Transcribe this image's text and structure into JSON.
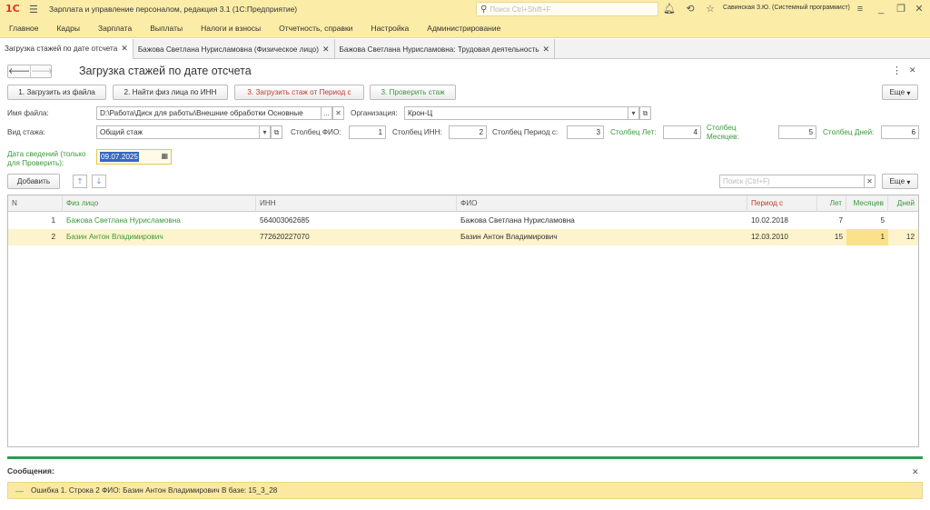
{
  "app": {
    "logo": "1С",
    "title": "Зарплата и управление персоналом, редакция 3.1  (1С:Предприятие)",
    "search_placeholder": "Поиск Ctrl+Shift+F",
    "user": "Савинская З.Ю. (Системный программист)"
  },
  "main_menu": [
    "Главное",
    "Кадры",
    "Зарплата",
    "Выплаты",
    "Налоги и взносы",
    "Отчетность, справки",
    "Настройка",
    "Администрирование"
  ],
  "tabs": [
    {
      "label": "Загрузка стажей по дате отсчета"
    },
    {
      "label": "Бажова Светлана Нурисламовна (Физическое лицо)"
    },
    {
      "label": "Бажова Светлана Нурисламовна: Трудовая деятельность"
    }
  ],
  "form": {
    "title": "Загрузка стажей по дате отсчета",
    "buttons": {
      "load_file": "1. Загрузить из файла",
      "find_by_inn": "2. Найти физ лица по ИНН",
      "load_from_period": "3. Загрузить стаж от Период с",
      "check": "3. Проверить стаж",
      "more": "Еще"
    },
    "file_label": "Имя файла:",
    "file_value": "D:\\Работа\\Диск для работы\\Внешние обработки Основные",
    "ellipsis": "...",
    "org_label": "Организация:",
    "org_value": "Крон-Ц",
    "type_label": "Вид стажа:",
    "type_value": "Общий стаж",
    "col_fio_label": "Столбец ФИО:",
    "col_fio_value": "1",
    "col_inn_label": "Столбец ИНН:",
    "col_inn_value": "2",
    "col_period_label": "Столбец Период с:",
    "col_period_value": "3",
    "col_years_label": "Столбец Лет:",
    "col_years_value": "4",
    "col_months_label_1": "Столбец",
    "col_months_label_2": "Месяцев:",
    "col_months_value": "5",
    "col_days_label": "Столбец Дней:",
    "col_days_value": "6",
    "date_label_1": "Дата сведений (только",
    "date_label_2": "для Проверить):",
    "date_value": "09.07.2025",
    "add_button": "Добавить",
    "table_search_placeholder": "Поиск (Ctrl+F)",
    "table_more": "Еще"
  },
  "table": {
    "headers": {
      "n": "N",
      "person": "Физ лицо",
      "inn": "ИНН",
      "fio": "ФИО",
      "period": "Период с",
      "years": "Лет",
      "months": "Месяцев",
      "days": "Дней"
    },
    "rows": [
      {
        "n": "1",
        "person": "Бажова Светлана Нурисламовна",
        "inn": "564003062685",
        "fio": "Бажова Светлана Нурисламовна",
        "period": "10.02.2018",
        "years": "7",
        "months": "5",
        "days": ""
      },
      {
        "n": "2",
        "person": "Базин Антон Владимирович",
        "inn": "772620227070",
        "fio": "Базин Антон Владимирович",
        "period": "12.03.2010",
        "years": "15",
        "months": "1",
        "days": "12"
      }
    ]
  },
  "messages": {
    "title": "Сообщения:",
    "items": [
      "Ошибка 1. Строка 2 ФИО: Базин Антон Владимирович В базе: 15_3_28"
    ]
  },
  "colors": {
    "accent_yellow": "#fbeca8",
    "green": "#3a9a3a",
    "red": "#c0392b",
    "selection": "#fdf3cc"
  }
}
